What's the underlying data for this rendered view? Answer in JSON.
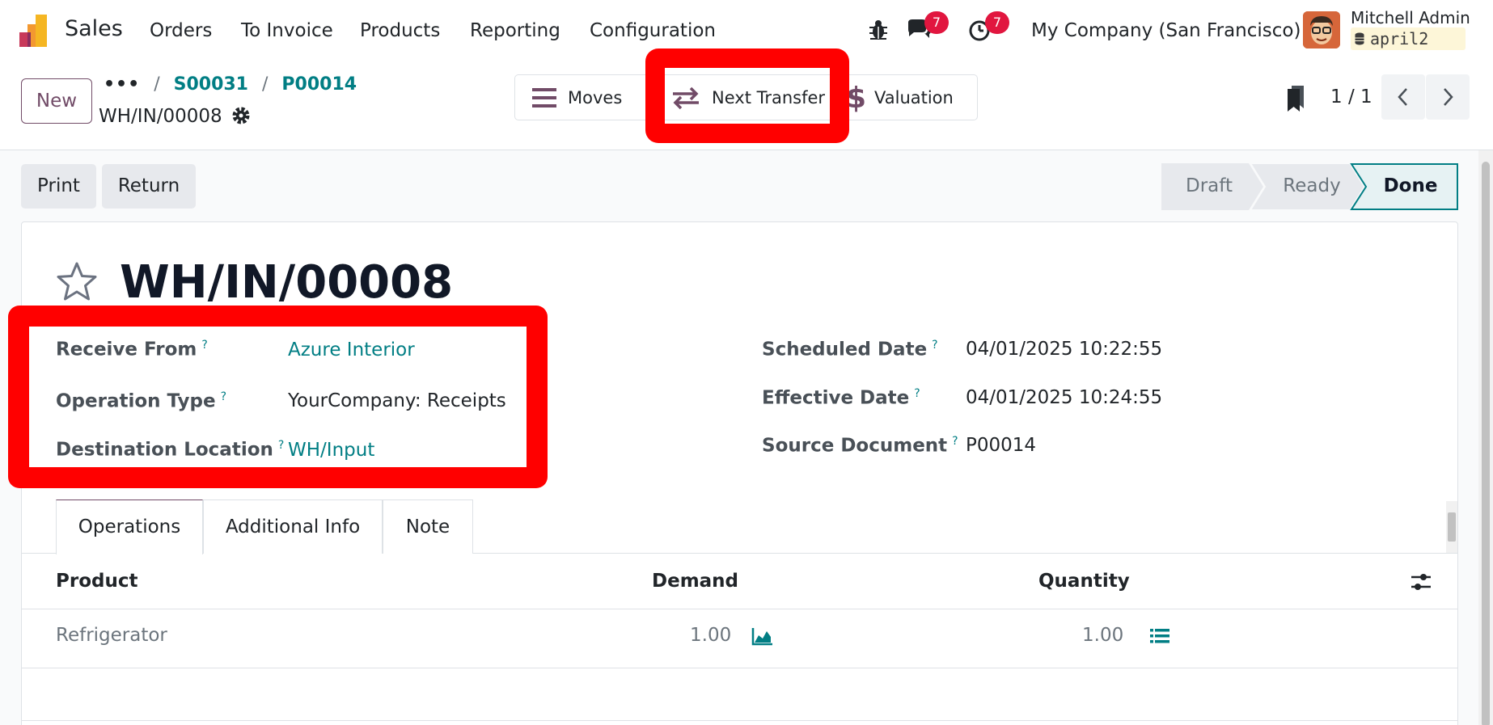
{
  "navbar": {
    "app_name": "Sales",
    "menu": [
      "Orders",
      "To Invoice",
      "Products",
      "Reporting",
      "Configuration"
    ],
    "messages_count": "7",
    "activities_count": "7",
    "company": "My Company (San Francisco)",
    "user_name": "Mitchell Admin",
    "database": "april2"
  },
  "control_panel": {
    "new_label": "New",
    "breadcrumb": {
      "dots": "•••",
      "sep": "/",
      "items": [
        "S00031",
        "P00014"
      ]
    },
    "record_name": "WH/IN/00008",
    "smart_buttons": {
      "moves": "Moves",
      "next_transfer": "Next Transfer",
      "valuation": "Valuation"
    },
    "pager": "1 / 1"
  },
  "actions": {
    "print": "Print",
    "return": "Return"
  },
  "statusbar": {
    "stages": [
      "Draft",
      "Ready",
      "Done"
    ],
    "current": "Done"
  },
  "form": {
    "title": "WH/IN/00008",
    "help_mark": "?",
    "left_fields": [
      {
        "label": "Receive From",
        "value": "Azure Interior"
      },
      {
        "label": "Operation Type",
        "value": "YourCompany: Receipts"
      },
      {
        "label": "Destination Location",
        "value": "WH/Input"
      }
    ],
    "right_fields": [
      {
        "label": "Scheduled Date",
        "value": "04/01/2025 10:22:55"
      },
      {
        "label": "Effective Date",
        "value": "04/01/2025 10:24:55"
      },
      {
        "label": "Source Document",
        "value": "P00014"
      }
    ],
    "tabs": [
      "Operations",
      "Additional Info",
      "Note"
    ],
    "table": {
      "headers": {
        "product": "Product",
        "demand": "Demand",
        "quantity": "Quantity"
      },
      "rows": [
        {
          "product": "Refrigerator",
          "demand": "1.00",
          "quantity": "1.00"
        }
      ]
    }
  },
  "colors": {
    "brand": "#714b67",
    "link": "#017e84",
    "highlight": "#ff0000",
    "badge": "#e1163f"
  }
}
